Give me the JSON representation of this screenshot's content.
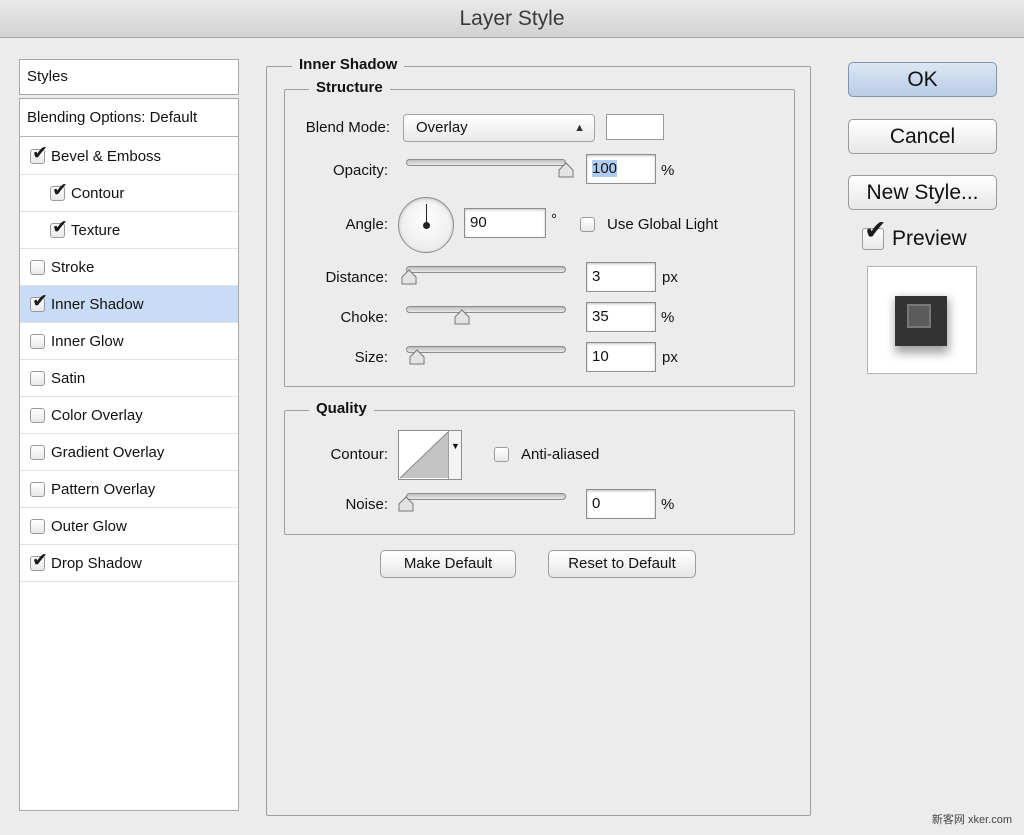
{
  "window": {
    "title": "Layer Style"
  },
  "sidebar": {
    "header": "Styles",
    "blending": "Blending Options: Default",
    "items": [
      {
        "label": "Bevel & Emboss",
        "checked": true,
        "indent": false,
        "selected": false
      },
      {
        "label": "Contour",
        "checked": true,
        "indent": true,
        "selected": false
      },
      {
        "label": "Texture",
        "checked": true,
        "indent": true,
        "selected": false
      },
      {
        "label": "Stroke",
        "checked": false,
        "indent": false,
        "selected": false
      },
      {
        "label": "Inner Shadow",
        "checked": true,
        "indent": false,
        "selected": true
      },
      {
        "label": "Inner Glow",
        "checked": false,
        "indent": false,
        "selected": false
      },
      {
        "label": "Satin",
        "checked": false,
        "indent": false,
        "selected": false
      },
      {
        "label": "Color Overlay",
        "checked": false,
        "indent": false,
        "selected": false
      },
      {
        "label": "Gradient Overlay",
        "checked": false,
        "indent": false,
        "selected": false
      },
      {
        "label": "Pattern Overlay",
        "checked": false,
        "indent": false,
        "selected": false
      },
      {
        "label": "Outer Glow",
        "checked": false,
        "indent": false,
        "selected": false
      },
      {
        "label": "Drop Shadow",
        "checked": true,
        "indent": false,
        "selected": false
      }
    ]
  },
  "panel": {
    "title": "Inner Shadow",
    "structure": {
      "title": "Structure",
      "blend_mode_label": "Blend Mode:",
      "blend_mode_value": "Overlay",
      "swatch_color": "#ffffff",
      "opacity_label": "Opacity:",
      "opacity_value": "100",
      "opacity_unit": "%",
      "opacity_fraction": 1.0,
      "angle_label": "Angle:",
      "angle_value": "90",
      "angle_unit": "°",
      "use_global_light": "Use Global Light",
      "distance_label": "Distance:",
      "distance_value": "3",
      "distance_unit": "px",
      "distance_fraction": 0.02,
      "choke_label": "Choke:",
      "choke_value": "35",
      "choke_unit": "%",
      "choke_fraction": 0.35,
      "size_label": "Size:",
      "size_value": "10",
      "size_unit": "px",
      "size_fraction": 0.07
    },
    "quality": {
      "title": "Quality",
      "contour_label": "Contour:",
      "anti_aliased": "Anti-aliased",
      "noise_label": "Noise:",
      "noise_value": "0",
      "noise_unit": "%",
      "noise_fraction": 0.0
    },
    "make_default": "Make Default",
    "reset_default": "Reset to Default"
  },
  "actions": {
    "ok": "OK",
    "cancel": "Cancel",
    "new_style": "New Style...",
    "preview": "Preview",
    "preview_checked": true
  },
  "watermark": "新客网 xker.com",
  "colors": {
    "selection": "#c8dcf5",
    "ok_button": "#c3d5ea"
  },
  "icons": {
    "checkbox": "check-mark-icon",
    "select_arrows": "updown-arrows-icon",
    "contour_arrow": "triangle-down-icon",
    "angle_dial": "angle-dial-icon"
  }
}
